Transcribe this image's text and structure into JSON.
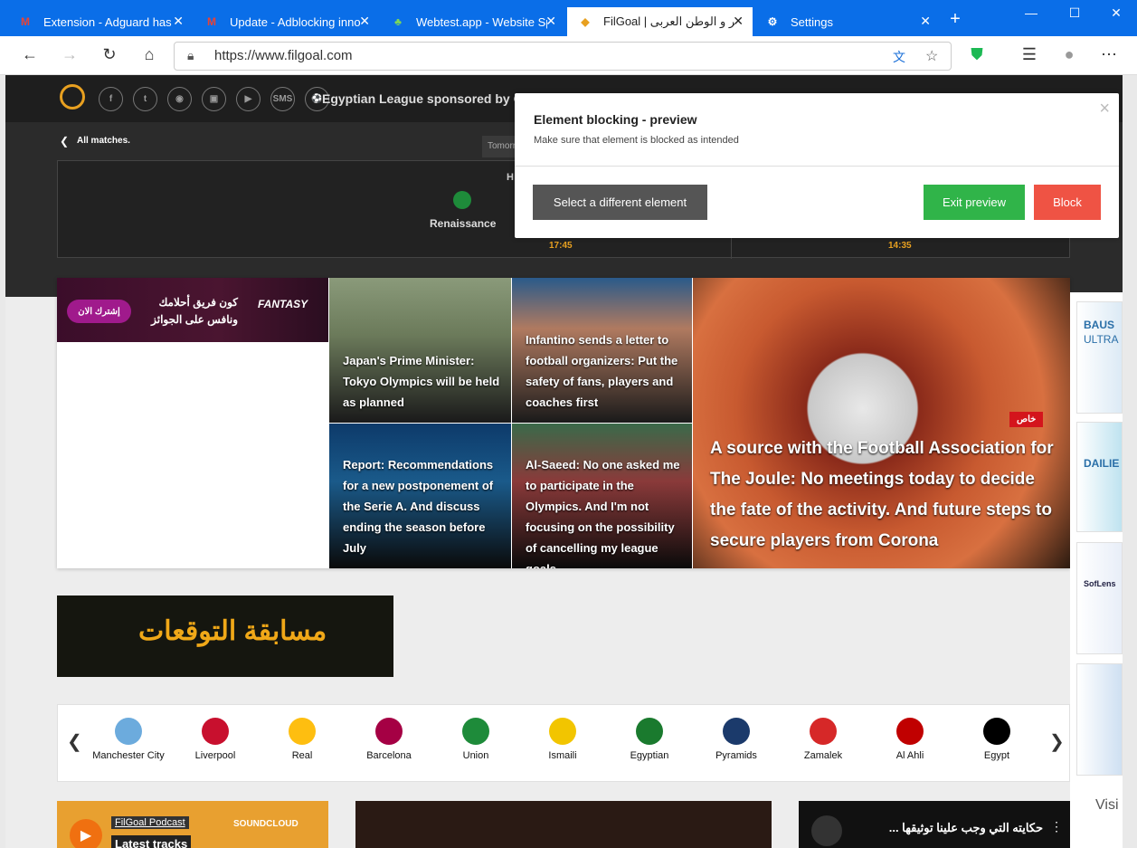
{
  "browser": {
    "tabs": [
      {
        "title": "Extension - Adguard has a",
        "icon": "gmail-icon",
        "active": false
      },
      {
        "title": "Update - Adblocking inno",
        "icon": "gmail-icon",
        "active": false
      },
      {
        "title": "Webtest.app - Website Sp",
        "icon": "sprout-icon",
        "active": false
      },
      {
        "title": "FilGoal | مصر و الوطن العربى",
        "icon": "filgoal-icon",
        "active": true
      },
      {
        "title": "Settings",
        "icon": "gear-icon",
        "active": false
      }
    ],
    "new_tab": "+",
    "url": "https://www.filgoal.com"
  },
  "site": {
    "league": "Egyptian League sponsored by OPPO",
    "social_sms": "SMS",
    "all_matches": "All matches.",
    "tomorrow": "Tomorr",
    "home_label": "H",
    "team_left": "Renaissance",
    "time_left": "17:45",
    "time_right": "14:35"
  },
  "dialog": {
    "title": "Element blocking - preview",
    "subtitle": "Make sure that element is blocked as intended",
    "select_label": "Select a different element",
    "exit_label": "Exit preview",
    "block_label": "Block",
    "colors": {
      "select": "#555555",
      "exit": "#30b449",
      "block": "#ef5344"
    }
  },
  "fantasy": {
    "subscribe": "إشترك الان",
    "line1": "كون فريق أحلامك",
    "line2": "ونافس على الجوائز",
    "logo": "FANTASY"
  },
  "news": [
    {
      "text": "Japan's Prime Minister: Tokyo Olympics will be held as planned"
    },
    {
      "text": "Infantino sends a letter to football organizers: Put the safety of fans, players and coaches first"
    },
    {
      "text": "Report: Recommendations for a new postponement of the Serie A. And discuss ending the season before July"
    },
    {
      "text": "Al-Saeed: No one asked me to participate in the Olympics. And I'm not focusing on the possibility of cancelling my league goals."
    },
    {
      "text": "A source with the Football Association for The Joule: No meetings today to decide the fate of the activity. And future steps to secure players from Corona",
      "badge": "خاص"
    }
  ],
  "predictions": {
    "title": "مسابقة التوقعات"
  },
  "teams": [
    {
      "name": "Manchester City",
      "color": "#6cabdd"
    },
    {
      "name": "Liverpool",
      "color": "#c8102e"
    },
    {
      "name": "Real",
      "color": "#febe10"
    },
    {
      "name": "Barcelona",
      "color": "#a50044"
    },
    {
      "name": "Union",
      "color": "#1e8b3a"
    },
    {
      "name": "Ismaili",
      "color": "#f2c500"
    },
    {
      "name": "Egyptian",
      "color": "#1a7a2e"
    },
    {
      "name": "Pyramids",
      "color": "#1b3a6b"
    },
    {
      "name": "Zamalek",
      "color": "#d62828"
    },
    {
      "name": "Al Ahli",
      "color": "#c00000"
    },
    {
      "name": "Egypt",
      "color": "#000000"
    }
  ],
  "podcast": {
    "label": "FilGoal Podcast",
    "tracks": "Latest tracks",
    "soundcloud": "SOUNDCLOUD"
  },
  "video": {
    "title": "حكايته التي وجب علينا توثيقها ..."
  },
  "ads": {
    "a1": "BAUS",
    "a1b": "ULTRA",
    "a2": "DAILIE",
    "a3": "SofLens",
    "visit": "Visi"
  }
}
